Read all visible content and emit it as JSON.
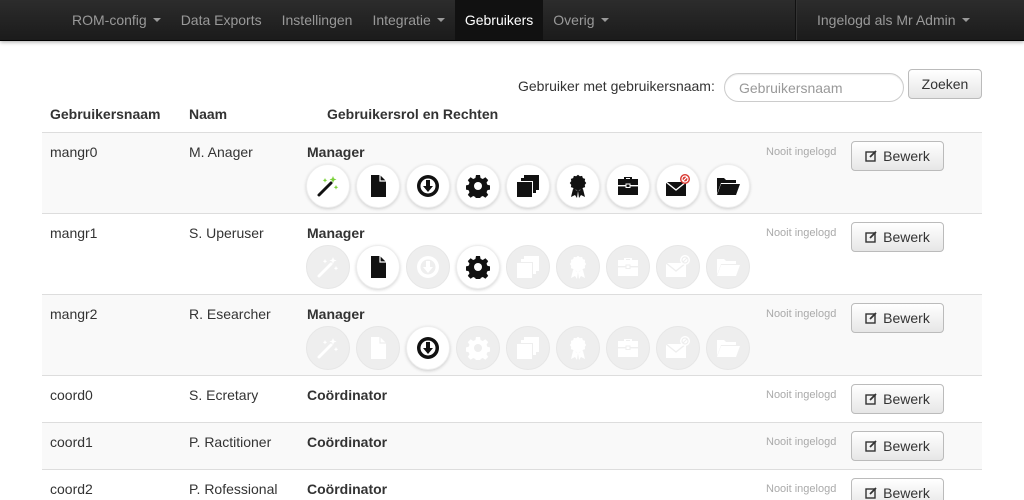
{
  "navbar": {
    "items": [
      {
        "label": "ROM-config",
        "dropdown": true
      },
      {
        "label": "Data Exports",
        "dropdown": false
      },
      {
        "label": "Instellingen",
        "dropdown": false
      },
      {
        "label": "Integratie",
        "dropdown": true
      },
      {
        "label": "Gebruikers",
        "dropdown": false,
        "active": true
      },
      {
        "label": "Overig",
        "dropdown": true
      }
    ],
    "user_menu": "Ingelogd als Mr Admin"
  },
  "search": {
    "label": "Gebruiker met gebruikersnaam:",
    "placeholder": "Gebruikersnaam",
    "button": "Zoeken"
  },
  "table": {
    "headers": {
      "username": "Gebruikersnaam",
      "name": "Naam",
      "role": "Gebruikersrol en Rechten"
    },
    "edit_label": "Bewerk",
    "rows": [
      {
        "username": "mangr0",
        "name": "M. Anager",
        "role": "Manager",
        "last_login": "Nooit ingelogd",
        "permissions": [
          true,
          true,
          true,
          true,
          true,
          true,
          true,
          true,
          true
        ]
      },
      {
        "username": "mangr1",
        "name": "S. Uperuser",
        "role": "Manager",
        "last_login": "Nooit ingelogd",
        "permissions": [
          false,
          true,
          false,
          true,
          false,
          false,
          false,
          false,
          false
        ]
      },
      {
        "username": "mangr2",
        "name": "R. Esearcher",
        "role": "Manager",
        "last_login": "Nooit ingelogd",
        "permissions": [
          false,
          false,
          true,
          false,
          false,
          false,
          false,
          false,
          false
        ]
      },
      {
        "username": "coord0",
        "name": "S. Ecretary",
        "role": "Coördinator",
        "last_login": "Nooit ingelogd"
      },
      {
        "username": "coord1",
        "name": "P. Ractitioner",
        "role": "Coördinator",
        "last_login": "Nooit ingelogd"
      },
      {
        "username": "coord2",
        "name": "P. Rofessional",
        "role": "Coördinator",
        "last_login": "Nooit ingelogd"
      }
    ]
  },
  "permission_icons": [
    "magic-wand-icon",
    "document-icon",
    "download-circle-icon",
    "gear-icon",
    "copy-stack-icon",
    "badge-icon",
    "briefcase-icon",
    "mail-blocked-icon",
    "folder-open-icon"
  ],
  "colors": {
    "active_icon": "#111111",
    "inactive_icon": "#ffffff",
    "blocked_badge": "#d9362f",
    "wand_sparkle": "#7bd13a"
  }
}
